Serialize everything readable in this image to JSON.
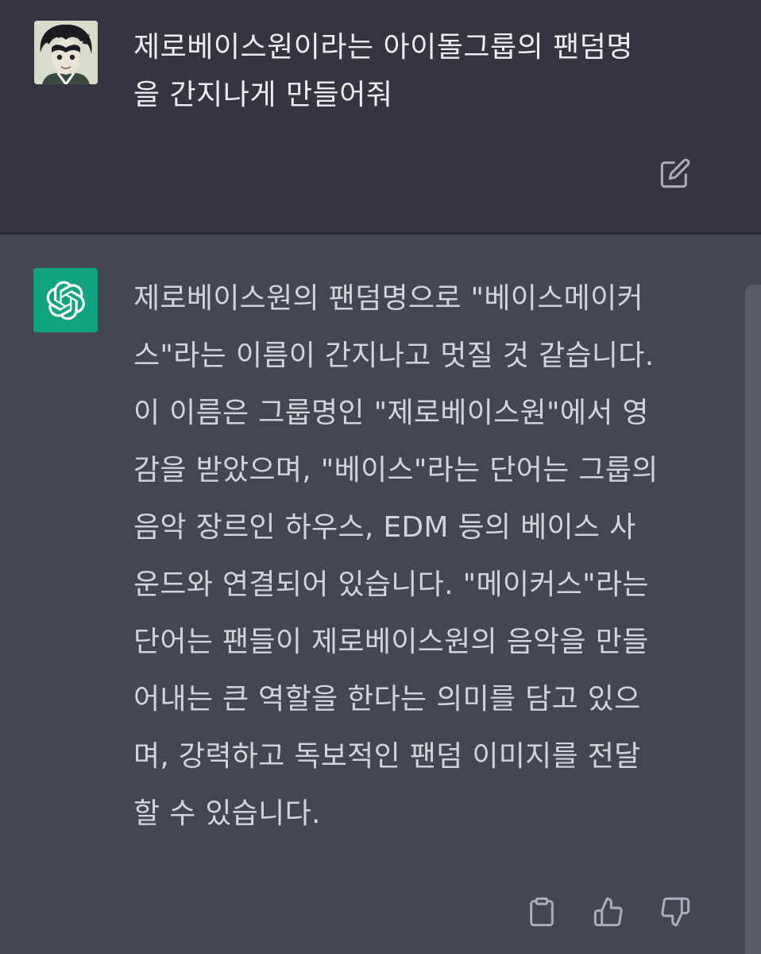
{
  "user_message": {
    "text": "제로베이스원이라는 아이돌그룹의 팬덤명을 간지나게 만들어줘",
    "line1": "제로베이스원이라는 아이돌그룹의 팬덤명",
    "line2": "을 간지나게 만들어줘"
  },
  "assistant_message": {
    "lines": [
      "제로베이스원의 팬덤명으로 \"베이스메이커",
      "스\"라는 이름이 간지나고 멋질 것 같습니다.",
      "이 이름은 그룹명인 \"제로베이스원\"에서 영",
      "감을 받았으며, \"베이스\"라는 단어는 그룹의",
      "음악 장르인 하우스, EDM 등의 베이스 사",
      "운드와 연결되어 있습니다. \"메이커스\"라는",
      "단어는 팬들이 제로베이스원의 음악을 만들",
      "어내는 큰 역할을 한다는 의미를 담고 있으",
      "며, 강력하고 독보적인 팬덤 이미지를 전달",
      "할 수 있습니다."
    ]
  },
  "icons": {
    "edit": "edit-icon",
    "copy": "clipboard-icon",
    "like": "thumbs-up-icon",
    "dislike": "thumbs-down-icon",
    "bot_logo": "openai-logo-icon"
  },
  "colors": {
    "user_bg": "#343541",
    "assistant_bg": "#444654",
    "accent": "#10a37f",
    "text": "#ececf1",
    "icon": "#acacbe"
  }
}
